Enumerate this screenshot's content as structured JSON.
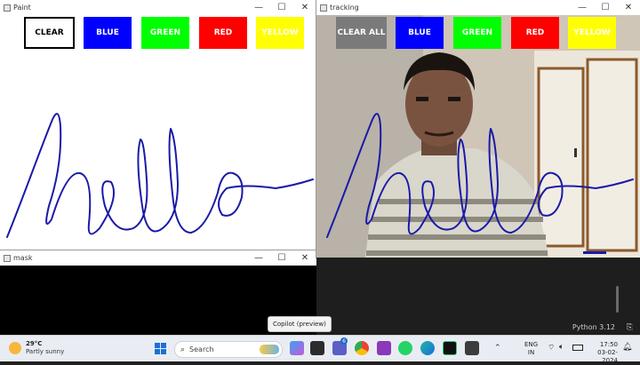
{
  "paint_window": {
    "title": "Paint",
    "buttons": [
      {
        "label": "CLEAR",
        "color": "#ffffff",
        "text_color": "#000000"
      },
      {
        "label": "BLUE",
        "color": "#0000ff",
        "text_color": "#ffffff"
      },
      {
        "label": "GREEN",
        "color": "#00ff00",
        "text_color": "#ffffff"
      },
      {
        "label": "RED",
        "color": "#ff0000",
        "text_color": "#ffffff"
      },
      {
        "label": "YELLOW",
        "color": "#ffff00",
        "text_color": "#ffffff"
      }
    ],
    "ink_color": "#1a1aa8"
  },
  "tracking_window": {
    "title": "tracking",
    "buttons": [
      {
        "label": "CLEAR ALL",
        "color": "#7a7a7a",
        "text_color": "#ffffff"
      },
      {
        "label": "BLUE",
        "color": "#0000ff",
        "text_color": "#ffffff"
      },
      {
        "label": "GREEN",
        "color": "#00ff00",
        "text_color": "#ffffff"
      },
      {
        "label": "RED",
        "color": "#ff0000",
        "text_color": "#ffffff"
      },
      {
        "label": "YELLOW",
        "color": "#ffff00",
        "text_color": "#ffffff"
      }
    ]
  },
  "mask_window": {
    "title": "mask"
  },
  "tooltip": "Copilot (preview)",
  "python_status": "Python 3.12",
  "taskbar": {
    "weather_temp": "29°C",
    "weather_desc": "Partly sunny",
    "search_placeholder": "Search",
    "lang_line1": "ENG",
    "lang_line2": "IN",
    "time": "17:50",
    "date": "03-02-2024",
    "notification_count": "6"
  }
}
